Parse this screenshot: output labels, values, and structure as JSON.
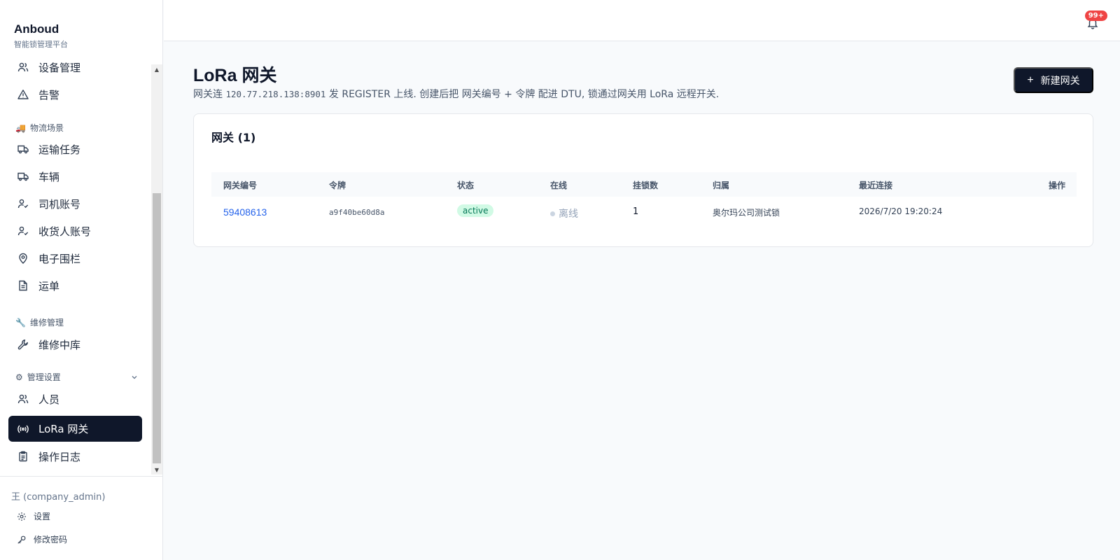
{
  "brand": {
    "name": "Anboud",
    "subtitle": "智能锁管理平台"
  },
  "sidebar": {
    "items_top": [
      {
        "label": "设备管理",
        "icon": "users-icon"
      },
      {
        "label": "告警",
        "icon": "alert-triangle-icon"
      }
    ],
    "group_logistics": {
      "label": "物流场景",
      "icon": "truck-emoji-icon"
    },
    "items_logistics": [
      {
        "label": "运输任务",
        "icon": "truck-icon"
      },
      {
        "label": "车辆",
        "icon": "truck-icon"
      },
      {
        "label": "司机账号",
        "icon": "user-check-icon"
      },
      {
        "label": "收货人账号",
        "icon": "user-check-icon"
      },
      {
        "label": "电子围栏",
        "icon": "map-pin-icon"
      },
      {
        "label": "运单",
        "icon": "file-text-icon"
      }
    ],
    "group_repair": {
      "label": "维修管理",
      "icon": "wrench-emoji-icon"
    },
    "items_repair": [
      {
        "label": "维修中库",
        "icon": "wrench-icon"
      }
    ],
    "group_admin": {
      "label": "管理设置",
      "icon": "gear-emoji-icon"
    },
    "items_admin": [
      {
        "label": "人员",
        "icon": "users-icon"
      },
      {
        "label": "LoRa 网关",
        "icon": "radio-icon",
        "active": true
      },
      {
        "label": "操作日志",
        "icon": "clipboard-icon"
      }
    ]
  },
  "user": {
    "name": "王 (company_admin)",
    "settings_label": "设置",
    "password_label": "修改密码"
  },
  "topbar": {
    "notification_count": "99+"
  },
  "page": {
    "title": "LoRa 网关",
    "desc_prefix": "网关连 ",
    "desc_address": "120.77.218.138:8901",
    "desc_suffix": " 发 REGISTER 上线. 创建后把 网关编号 + 令牌 配进 DTU, 锁通过网关用 LoRa 远程开关.",
    "new_button": "新建网关"
  },
  "table": {
    "title": "网关 (1)",
    "columns": [
      "网关编号",
      "令牌",
      "状态",
      "在线",
      "挂锁数",
      "归属",
      "最近连接",
      "操作"
    ],
    "rows": [
      {
        "gateway_id": "59408613",
        "token": "a9f40be60d8a",
        "status": "active",
        "online": "离线",
        "lock_count": "1",
        "owner": "奥尔玛公司测试锁",
        "last_connected": "2026/7/20 19:20:24"
      }
    ]
  },
  "colors": {
    "primary": "#0f172a",
    "link": "#2563eb",
    "success_bg": "#d1fae5",
    "success_fg": "#047857",
    "badge": "#ef4444"
  }
}
